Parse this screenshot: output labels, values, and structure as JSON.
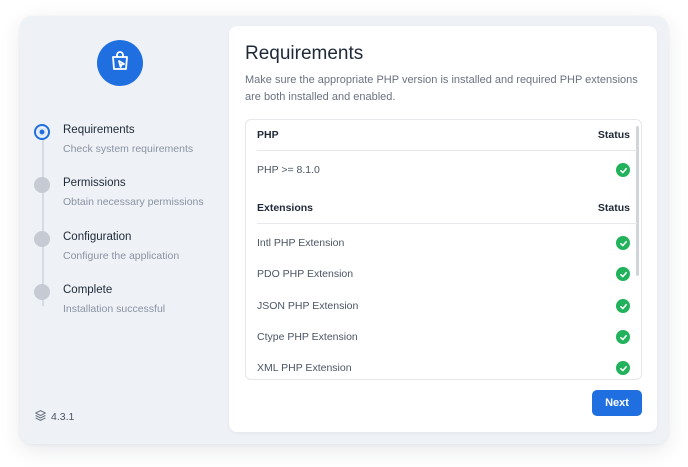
{
  "colors": {
    "accent": "#1f6fe0",
    "success": "#22b25c",
    "muted": "#8a93a2"
  },
  "sidebar": {
    "logo_icon": "shopping-bag-cursor-icon",
    "steps": [
      {
        "title": "Requirements",
        "description": "Check system requirements",
        "state": "active"
      },
      {
        "title": "Permissions",
        "description": "Obtain necessary permissions",
        "state": "pending"
      },
      {
        "title": "Configuration",
        "description": "Configure the application",
        "state": "pending"
      },
      {
        "title": "Complete",
        "description": "Installation successful",
        "state": "pending"
      }
    ],
    "version_icon": "layers-icon",
    "version": "4.3.1"
  },
  "main": {
    "title": "Requirements",
    "description": "Make sure the appropriate PHP version is installed and required PHP extensions are both installed and enabled.",
    "php_section": {
      "header": "PHP",
      "status_header": "Status",
      "rows": [
        {
          "label": "PHP >= 8.1.0",
          "status": "check-icon"
        }
      ]
    },
    "extensions_section": {
      "header": "Extensions",
      "status_header": "Status",
      "rows": [
        {
          "label": "Intl PHP Extension",
          "status": "check-icon"
        },
        {
          "label": "PDO PHP Extension",
          "status": "check-icon"
        },
        {
          "label": "JSON PHP Extension",
          "status": "check-icon"
        },
        {
          "label": "Ctype PHP Extension",
          "status": "check-icon"
        },
        {
          "label": "XML PHP Extension",
          "status": "check-icon"
        }
      ]
    },
    "next_label": "Next"
  }
}
